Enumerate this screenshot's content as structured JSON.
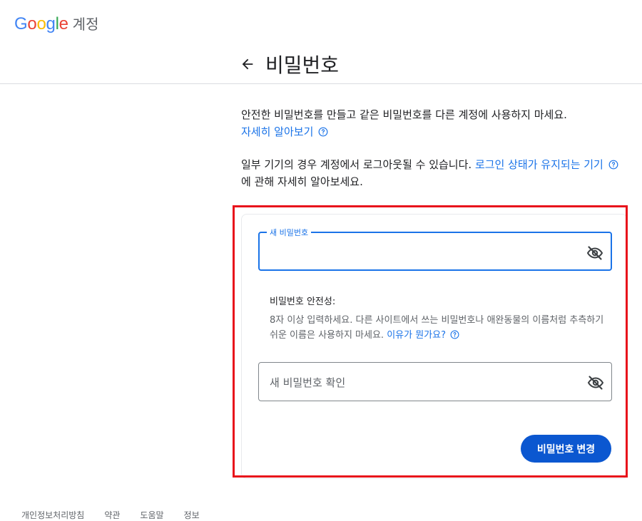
{
  "header": {
    "logo_letters": [
      {
        "char": "G",
        "color": "#4285F4"
      },
      {
        "char": "o",
        "color": "#EA4335"
      },
      {
        "char": "o",
        "color": "#FBBC05"
      },
      {
        "char": "g",
        "color": "#4285F4"
      },
      {
        "char": "l",
        "color": "#34A853"
      },
      {
        "char": "e",
        "color": "#EA4335"
      }
    ],
    "product_label": "계정",
    "back_icon": "arrow-left-icon",
    "page_title": "비밀번호"
  },
  "intro": {
    "text": "안전한 비밀번호를 만들고 같은 비밀번호를 다른 계정에 사용하지 마세요.",
    "learn_more_link": "자세히 알아보기",
    "help_icon": "help-circle-icon"
  },
  "signout_notice": {
    "text_before": "일부 기기의 경우 계정에서 로그아웃될 수 있습니다. ",
    "link": "로그인 상태가 유지되는 기기",
    "text_after": "에 관해 자세히 알아보세요."
  },
  "form": {
    "new_password": {
      "label": "새 비밀번호",
      "value": "",
      "visibility_icon": "eye-off-icon"
    },
    "strength": {
      "title": "비밀번호 안전성:",
      "description": "8자 이상 입력하세요. 다른 사이트에서 쓰는 비밀번호나 애완동물의 이름처럼 추측하기 쉬운 이름은 사용하지 마세요. ",
      "why_link": "이유가 뭔가요?"
    },
    "confirm_password": {
      "placeholder": "새 비밀번호 확인",
      "value": "",
      "visibility_icon": "eye-off-icon"
    },
    "submit_label": "비밀번호 변경"
  },
  "footer": {
    "links": [
      "개인정보처리방침",
      "약관",
      "도움말",
      "정보"
    ]
  },
  "colors": {
    "accent": "#1a73e8",
    "button": "#0b57d0",
    "highlight_border": "#e8121b"
  }
}
